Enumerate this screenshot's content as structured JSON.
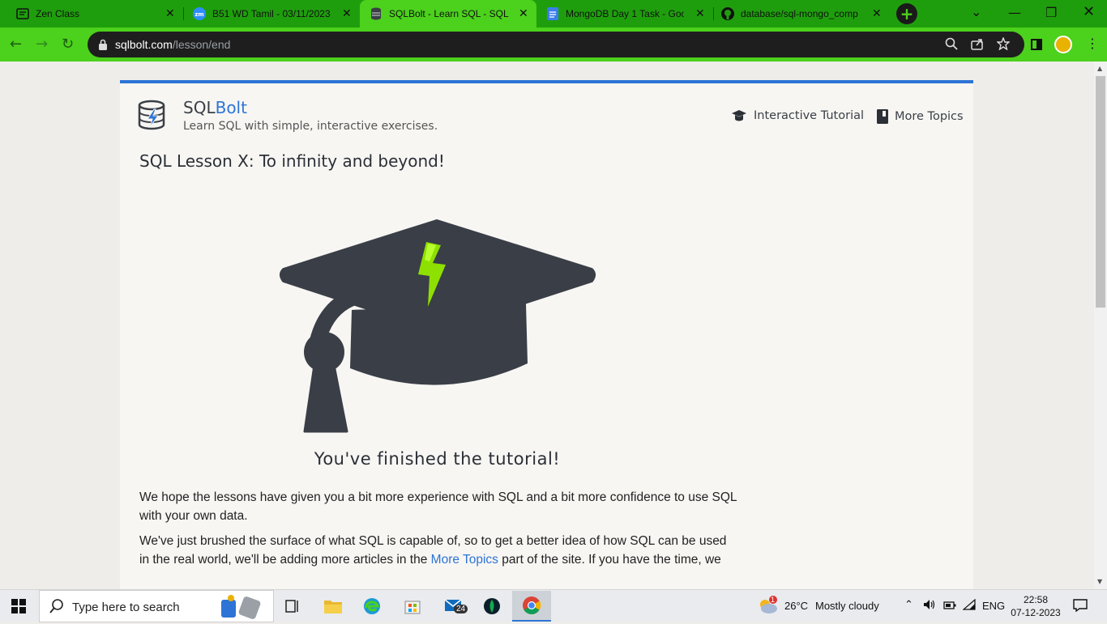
{
  "browser": {
    "tabs": [
      {
        "title": "Zen Class",
        "icon": "zen-class-icon"
      },
      {
        "title": "B51 WD Tamil - 03/11/2023",
        "icon": "zoom-icon"
      },
      {
        "title": "SQLBolt - Learn SQL - SQL L",
        "icon": "sqlbolt-icon",
        "active": true
      },
      {
        "title": "MongoDB Day 1 Task - Goo",
        "icon": "google-docs-icon"
      },
      {
        "title": "database/sql-mongo_comp",
        "icon": "github-icon"
      }
    ],
    "url_host": "sqlbolt.com",
    "url_path": "/lesson/end",
    "accent_color": "#4cd11c"
  },
  "site": {
    "brand_prefix": "SQL",
    "brand_suffix": "Bolt",
    "tagline": "Learn SQL with simple, interactive exercises.",
    "nav": {
      "tutorial": "Interactive Tutorial",
      "topics": "More Topics"
    }
  },
  "lesson": {
    "title": "SQL Lesson X: To infinity and beyond!",
    "finished": "You've finished the tutorial!",
    "para1": "We hope the lessons have given you a bit more experience with SQL and a bit more confidence to use SQL with your own data.",
    "para2_a": "We've just brushed the surface of what SQL is capable of, so to get a better idea of how SQL can be used in the real world, we'll be adding more articles in the ",
    "para2_link": "More Topics",
    "para2_b": " part of the site. If you have the time, we"
  },
  "taskbar": {
    "search_placeholder": "Type here to search",
    "weather_temp": "26°C",
    "weather_text": "Mostly cloudy",
    "weather_badge": "1",
    "mail_badge": "24",
    "language": "ENG",
    "time": "22:58",
    "date": "07-12-2023"
  }
}
